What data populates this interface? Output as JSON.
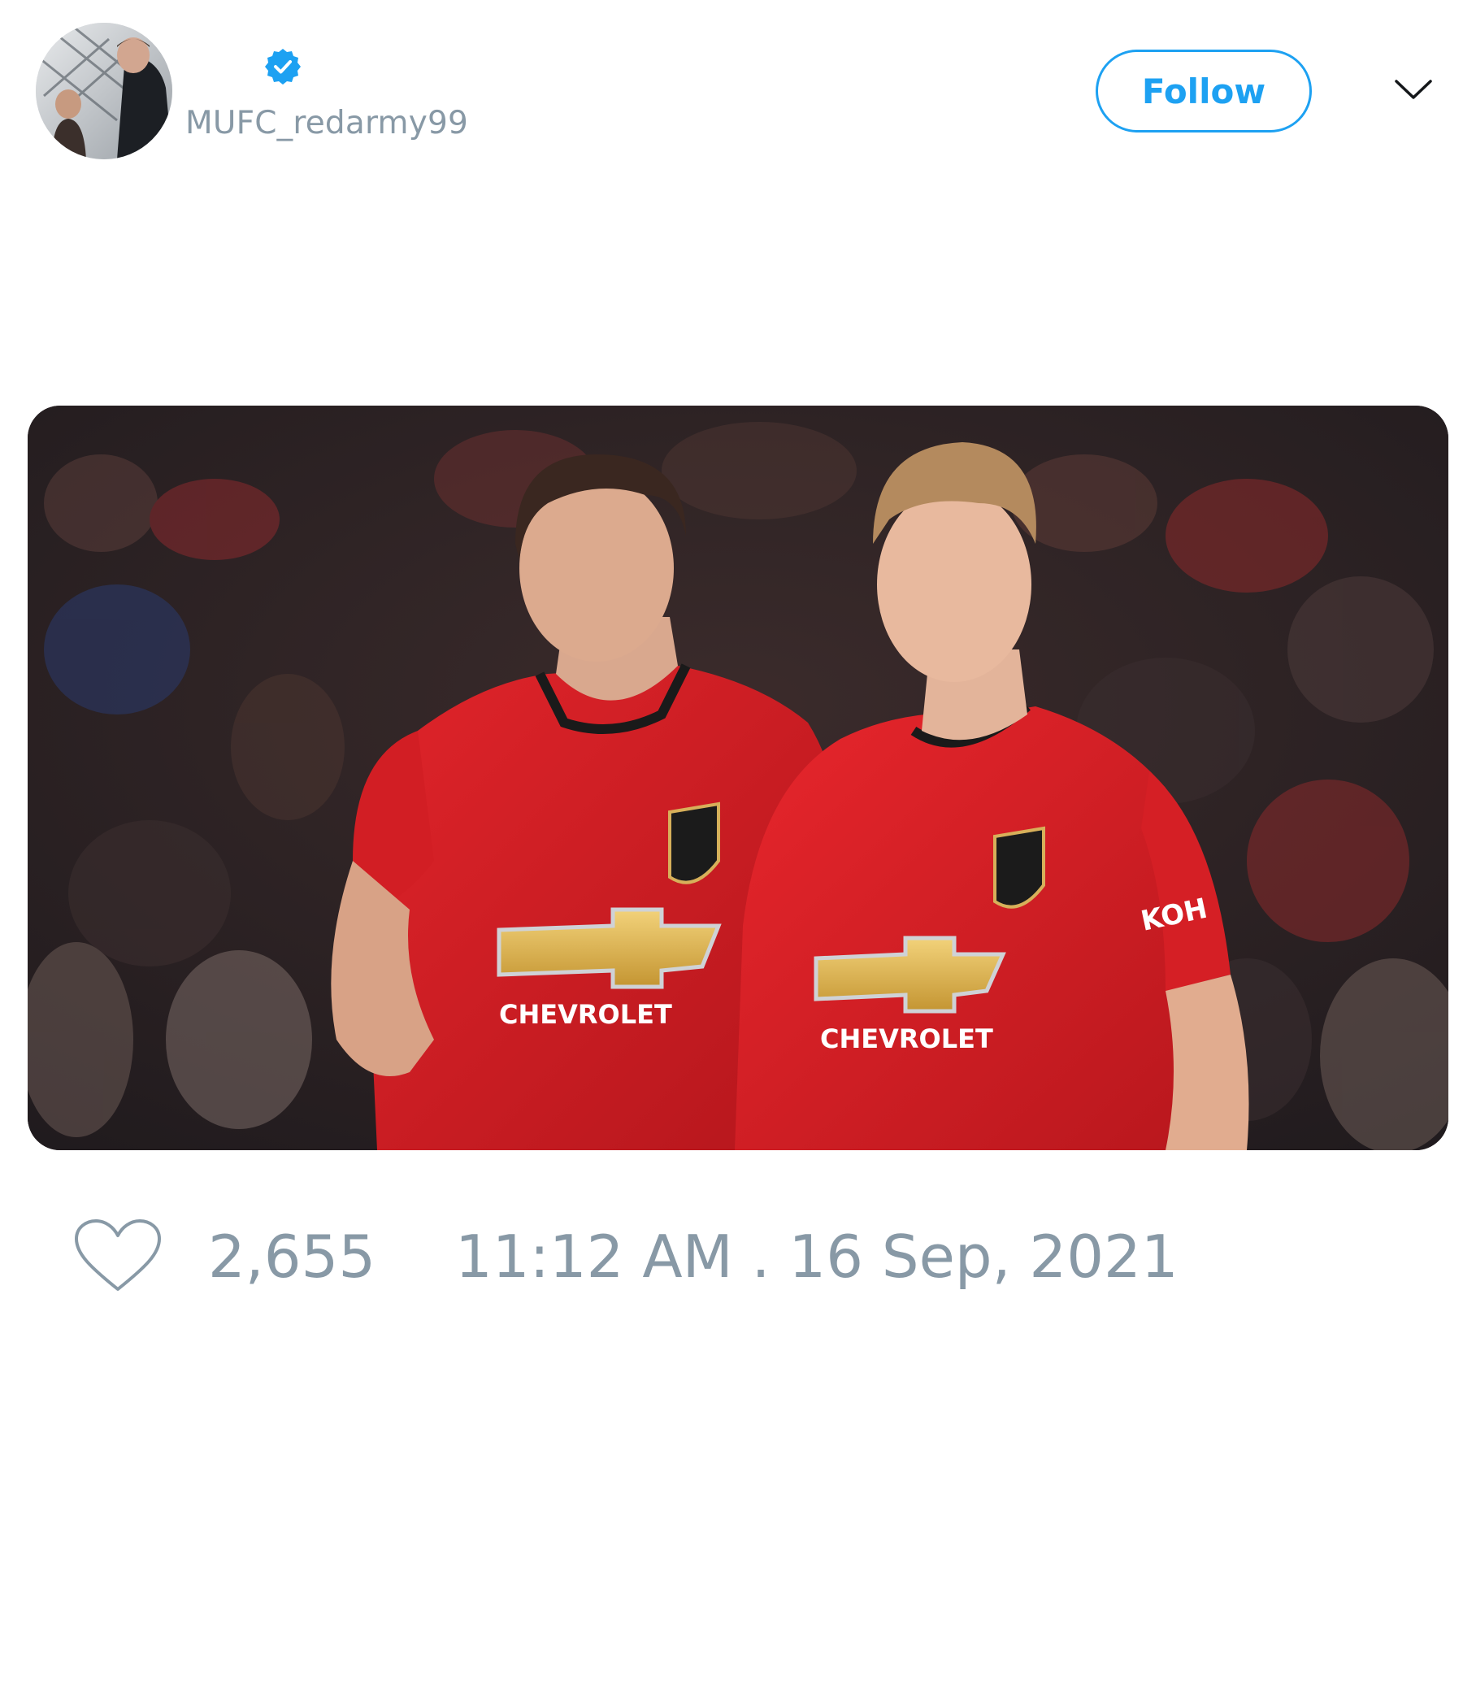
{
  "tweet": {
    "author": {
      "display_name": "",
      "handle": "MUFC_redarmy99",
      "verified": true,
      "avatar_icon": "avatar-photo"
    },
    "follow_label": "Follow",
    "menu_icon": "chevron-down-icon",
    "media": {
      "description_icon": "photo",
      "shirt_sponsor": "CHEVROLET",
      "sleeve_sponsor": "KOH"
    },
    "likes": "2,655",
    "like_icon": "heart-outline-icon",
    "timestamp": "11:12 AM . 16 Sep, 2021"
  },
  "colors": {
    "accent": "#1da1f2",
    "muted_text": "#8899a6",
    "primary_text": "#14171a",
    "background": "#ffffff"
  }
}
